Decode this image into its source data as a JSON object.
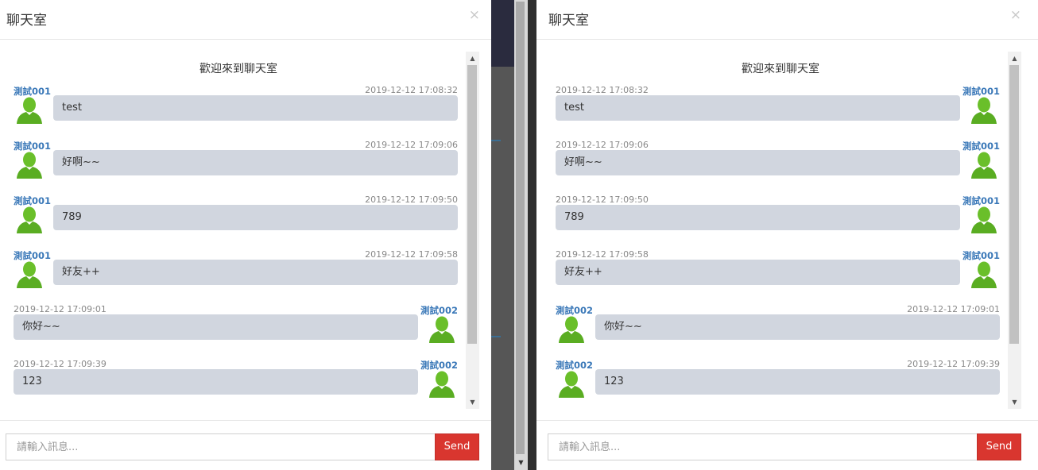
{
  "left_panel": {
    "title": "聊天室",
    "close_glyph": "×",
    "welcome": "歡迎來到聊天室",
    "messages": [
      {
        "name": "測試001",
        "time": "2019-12-12 17:08:32",
        "text": "test",
        "side": "left"
      },
      {
        "name": "測試001",
        "time": "2019-12-12 17:09:06",
        "text": "好啊~~",
        "side": "left"
      },
      {
        "name": "測試001",
        "time": "2019-12-12 17:09:50",
        "text": "789",
        "side": "left"
      },
      {
        "name": "測試001",
        "time": "2019-12-12 17:09:58",
        "text": "好友++",
        "side": "left"
      },
      {
        "name": "測試002",
        "time": "2019-12-12 17:09:01",
        "text": "你好~~",
        "side": "right"
      },
      {
        "name": "測試002",
        "time": "2019-12-12 17:09:39",
        "text": "123",
        "side": "right"
      }
    ],
    "input_placeholder": "請輸入訊息...",
    "send_label": "Send"
  },
  "right_panel": {
    "title": "聊天室",
    "close_glyph": "×",
    "welcome": "歡迎來到聊天室",
    "messages": [
      {
        "name": "測試001",
        "time": "2019-12-12 17:08:32",
        "text": "test",
        "side": "right"
      },
      {
        "name": "測試001",
        "time": "2019-12-12 17:09:06",
        "text": "好啊~~",
        "side": "right"
      },
      {
        "name": "測試001",
        "time": "2019-12-12 17:09:50",
        "text": "789",
        "side": "right"
      },
      {
        "name": "測試001",
        "time": "2019-12-12 17:09:58",
        "text": "好友++",
        "side": "right"
      },
      {
        "name": "測試002",
        "time": "2019-12-12 17:09:01",
        "text": "你好~~",
        "side": "left"
      },
      {
        "name": "測試002",
        "time": "2019-12-12 17:09:39",
        "text": "123",
        "side": "left"
      }
    ],
    "input_placeholder": "請輸入訊息...",
    "send_label": "Send"
  },
  "icons": {
    "avatar": "user-avatar-icon",
    "scroll_up": "triangle-up-icon",
    "scroll_down": "triangle-down-icon",
    "close": "close-icon"
  },
  "colors": {
    "username": "#3a78b8",
    "bubble": "#d1d6df",
    "send_button": "#d9362f",
    "avatar": "#6abf2a"
  }
}
